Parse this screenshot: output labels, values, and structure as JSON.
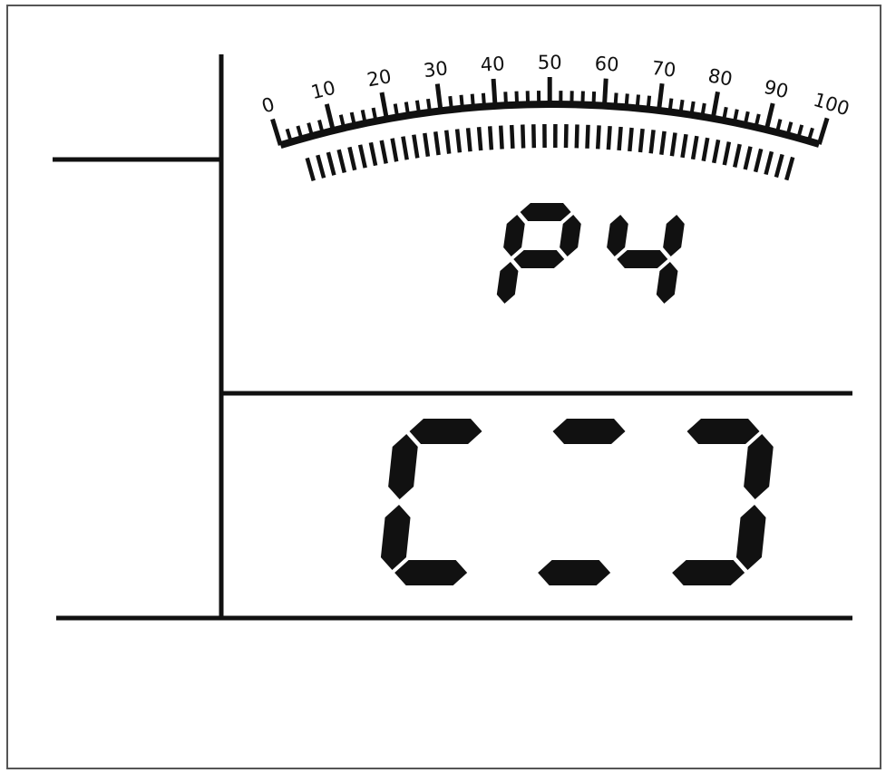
{
  "gauge": {
    "min": 0,
    "max": 100,
    "labels": [
      "0",
      "10",
      "20",
      "30",
      "40",
      "50",
      "60",
      "70",
      "80",
      "90",
      "100"
    ],
    "scale_minor_per_major": 4,
    "bar_segments": 46
  },
  "upper_display": {
    "text": "P4",
    "digits": [
      {
        "char": "P",
        "segments": [
          "a",
          "b",
          "f",
          "g",
          "e"
        ]
      },
      {
        "char": "4",
        "segments": [
          "b",
          "c",
          "f",
          "g"
        ]
      }
    ]
  },
  "lower_display": {
    "digits": [
      {
        "char": "[",
        "segments": [
          "a",
          "d",
          "e",
          "f"
        ]
      },
      {
        "char": "=",
        "segments": [
          "a",
          "d"
        ]
      },
      {
        "char": "]",
        "segments": [
          "a",
          "b",
          "c",
          "d"
        ]
      }
    ]
  },
  "colors": {
    "ink": "#111111",
    "background": "#ffffff",
    "frame": "#555555"
  }
}
